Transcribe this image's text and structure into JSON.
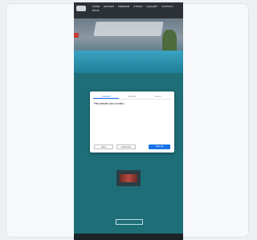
{
  "header": {
    "nav": [
      {
        "label": "HOME"
      },
      {
        "label": "OFFICES"
      },
      {
        "label": "PREMIUM"
      },
      {
        "label": "STUDIO"
      },
      {
        "label": "GALLERY"
      },
      {
        "label": "CONTACT"
      },
      {
        "label": "BOOK"
      }
    ]
  },
  "hero": {
    "title": ""
  },
  "intro": {
    "text": ""
  },
  "cookie_dialog": {
    "tabs": [
      {
        "label": "Consent"
      },
      {
        "label": "Details"
      },
      {
        "label": "About"
      }
    ],
    "title": "This website uses cookies",
    "body": "",
    "buttons": {
      "deny": "Deny",
      "customize": "Customize",
      "allow": "Allow all"
    }
  },
  "mid_text": {
    "text": ""
  },
  "lower_text": {
    "text": ""
  },
  "cta": {
    "label": ""
  },
  "footer": {
    "text": ""
  },
  "colors": {
    "page_bg": "#1e6e78",
    "header_bg": "#2b3136",
    "accent": "#1a73e8",
    "dialog_bg": "#ffffff"
  }
}
